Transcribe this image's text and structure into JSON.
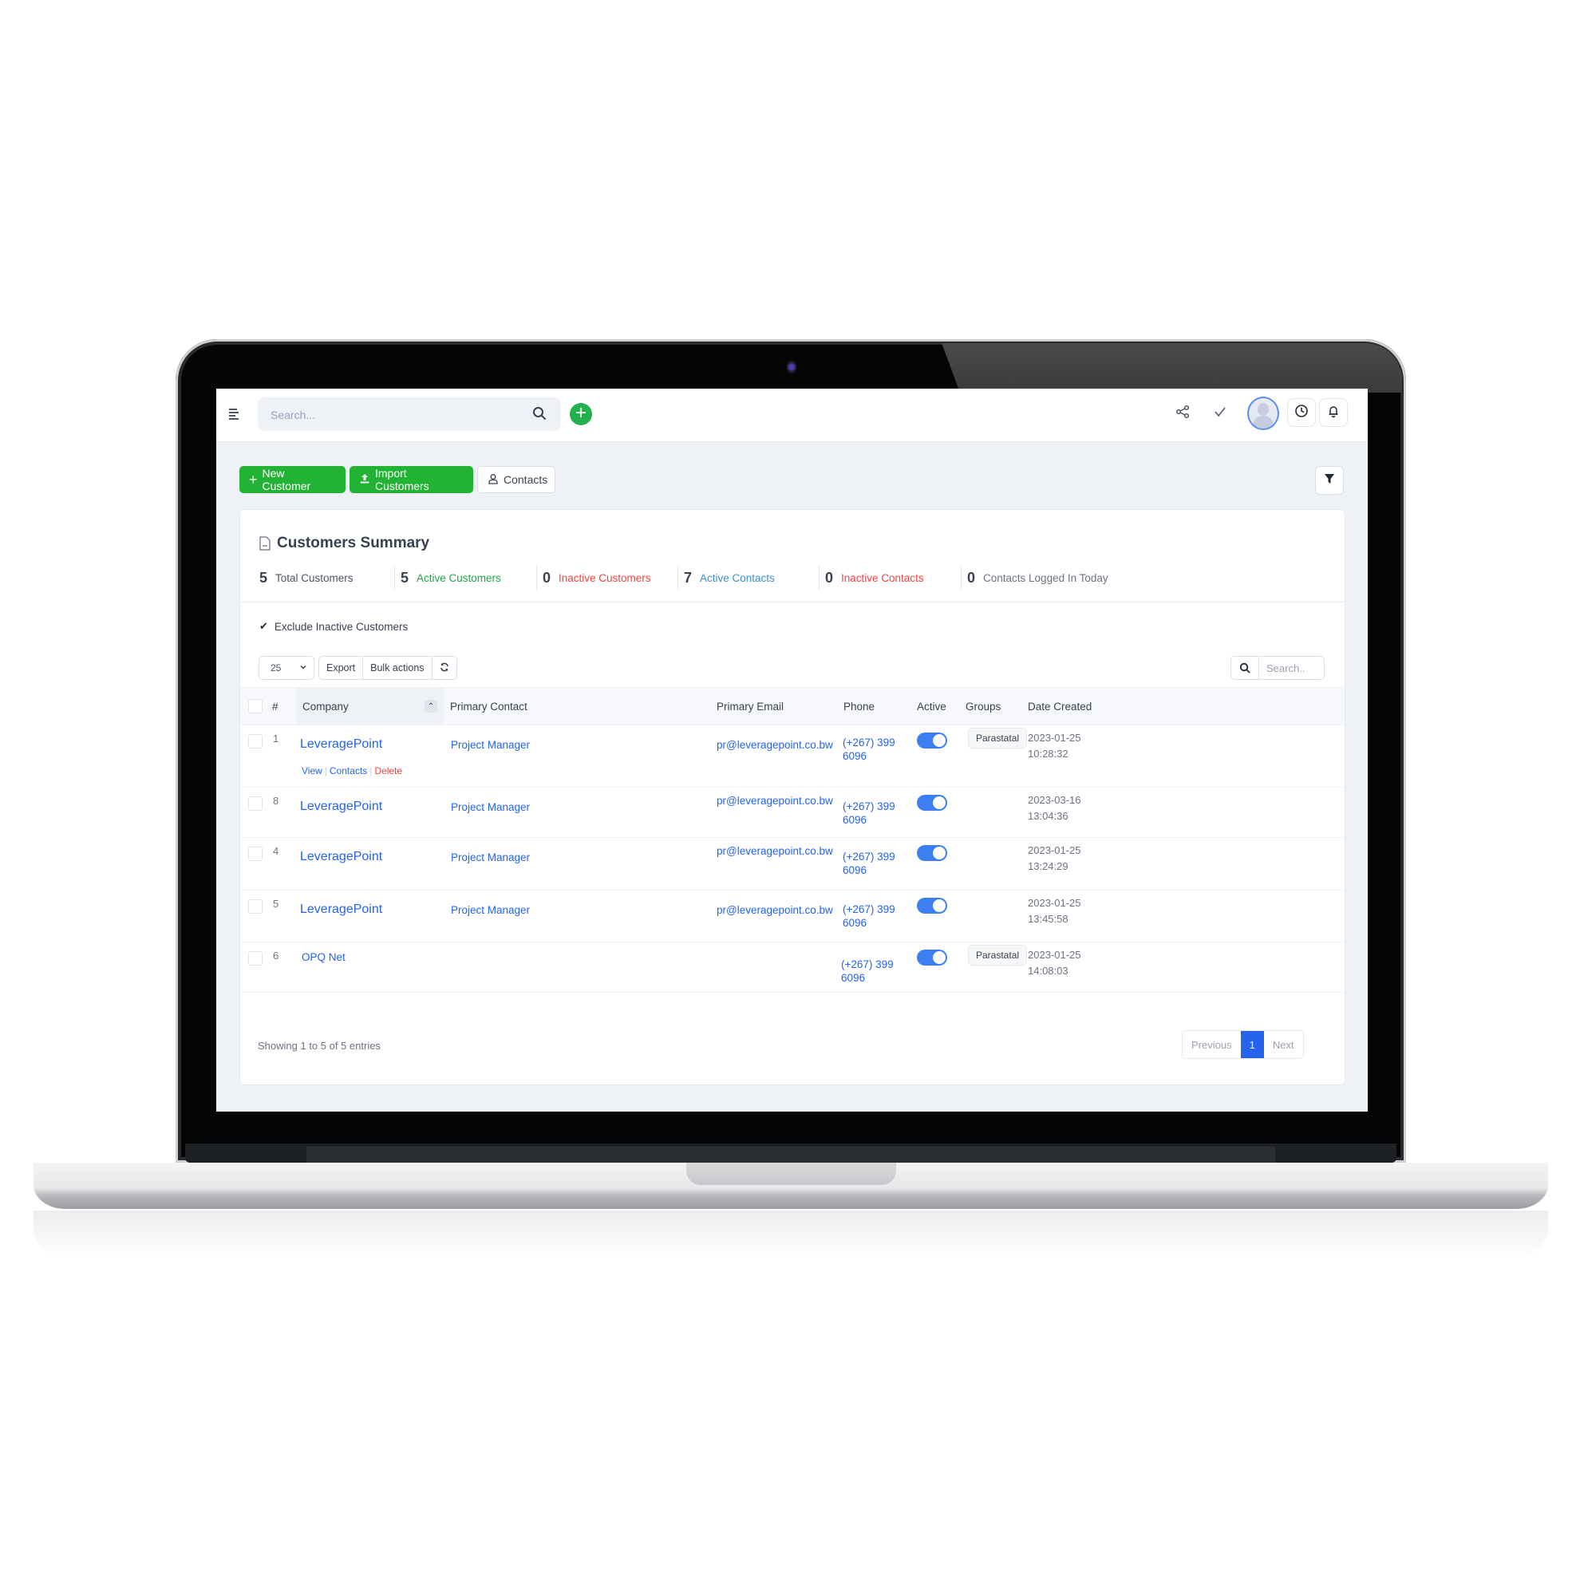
{
  "topbar": {
    "search_placeholder": "Search...",
    "icons": [
      "menu-icon",
      "search-icon",
      "plus-icon",
      "share-icon",
      "check-icon",
      "avatar",
      "clock-icon",
      "bell-icon"
    ]
  },
  "actions": {
    "new_customer": "New Customer",
    "import_customers": "Import Customers",
    "contacts": "Contacts"
  },
  "summary": {
    "title": "Customers Summary",
    "stats": [
      {
        "value": "5",
        "label": "Total Customers",
        "color": "#4b5563"
      },
      {
        "value": "5",
        "label": "Active Customers",
        "color": "#22a34a"
      },
      {
        "value": "0",
        "label": "Inactive Customers",
        "color": "#ef4444"
      },
      {
        "value": "7",
        "label": "Active Contacts",
        "color": "#3b8fd6"
      },
      {
        "value": "0",
        "label": "Inactive Contacts",
        "color": "#ef4444"
      },
      {
        "value": "0",
        "label": "Contacts Logged In Today",
        "color": "#6b7280"
      }
    ]
  },
  "filters": {
    "exclude_inactive_label": "Exclude Inactive Customers",
    "exclude_inactive_checked": true
  },
  "table_tools": {
    "page_size": "25",
    "export": "Export",
    "bulk_actions": "Bulk actions",
    "search_placeholder": "Search.."
  },
  "table": {
    "columns": [
      "#",
      "Company",
      "Primary Contact",
      "Primary Email",
      "Phone",
      "Active",
      "Groups",
      "Date Created"
    ],
    "row_actions": {
      "view": "View",
      "contacts": "Contacts",
      "delete": "Delete"
    },
    "rows": [
      {
        "id": "1",
        "company": "LeveragePoint",
        "contact": "Project Manager",
        "email": "pr@leveragepoint.co.bw",
        "phone1": "(+267) 399",
        "phone2": "6096",
        "active": true,
        "group": "Parastatal",
        "date": "2023-01-25",
        "time": "10:28:32"
      },
      {
        "id": "8",
        "company": "LeveragePoint",
        "contact": "Project Manager",
        "email": "pr@leveragepoint.co.bw",
        "phone1": "(+267) 399",
        "phone2": "6096",
        "active": true,
        "group": "",
        "date": "2023-03-16",
        "time": "13:04:36"
      },
      {
        "id": "4",
        "company": "LeveragePoint",
        "contact": "Project Manager",
        "email": "pr@leveragepoint.co.bw",
        "phone1": "(+267) 399",
        "phone2": "6096",
        "active": true,
        "group": "",
        "date": "2023-01-25",
        "time": "13:24:29"
      },
      {
        "id": "5",
        "company": "LeveragePoint",
        "contact": "Project Manager",
        "email": "pr@leveragepoint.co.bw",
        "phone1": "(+267) 399",
        "phone2": "6096",
        "active": true,
        "group": "",
        "date": "2023-01-25",
        "time": "13:45:58"
      },
      {
        "id": "6",
        "company": "OPQ Net",
        "contact": "",
        "email": "",
        "phone1": "(+267) 399",
        "phone2": "6096",
        "active": true,
        "group": "Parastatal",
        "date": "2023-01-25",
        "time": "14:08:03"
      }
    ]
  },
  "footer": {
    "showing": "Showing 1 to 5 of 5 entries",
    "previous": "Previous",
    "current_page": "1",
    "next": "Next"
  }
}
